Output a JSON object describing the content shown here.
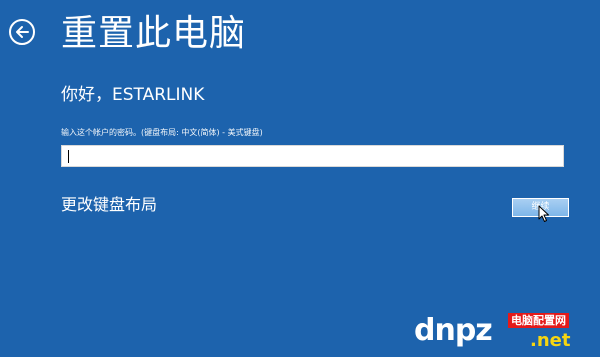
{
  "header": {
    "back_icon": "arrow-left-circle-icon",
    "title": "重置此电脑"
  },
  "account": {
    "greeting": "你好，ESTARLINK"
  },
  "password": {
    "prompt": "输入这个帐户的密码。(键盘布局: 中文(简体) - 美式键盘)",
    "value": "",
    "placeholder": ""
  },
  "actions": {
    "change_layout_label": "更改键盘布局",
    "continue_label": "继续",
    "cursor_icon": "mouse-pointer-icon"
  },
  "watermark": {
    "logo_text": "dnpz",
    "site_name": "电脑配置网",
    "domain_suffix": ".net"
  },
  "colors": {
    "background": "#1d63ad",
    "text": "#ffffff",
    "button_fill": "#8fc2ee",
    "watermark_red": "#e41a1a",
    "watermark_yellow": "#f5d511"
  }
}
